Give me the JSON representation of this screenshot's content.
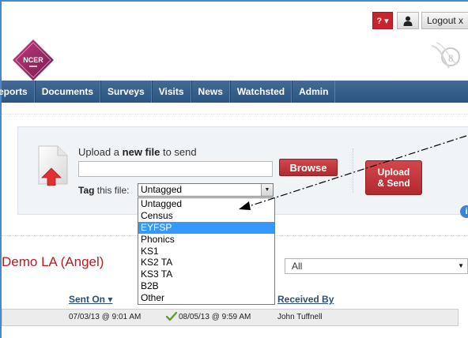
{
  "header": {
    "help_label": "? ▾",
    "logout_label": "Logout x",
    "logo_text": "NCER"
  },
  "nav": {
    "items": [
      "eports",
      "Documents",
      "Surveys",
      "Visits",
      "News",
      "Watchsted",
      "Admin"
    ]
  },
  "upload": {
    "label_pre": "Upload a ",
    "label_bold": "new file",
    "label_post": " to send",
    "browse_label": "Browse",
    "send_line1": "Upload",
    "send_line2": "& Send",
    "tag_label_bold": "Tag",
    "tag_label_rest": " this file:",
    "tag_selected": "Untagged"
  },
  "dropdown": {
    "options": [
      "Untagged",
      "Census",
      "EYFSP",
      "Phonics",
      "KS1",
      "KS2 TA",
      "KS3 TA",
      "B2B",
      "Other"
    ],
    "highlighted_index": 2
  },
  "section": {
    "title": "Demo LA (Angel)",
    "filter_value": "All"
  },
  "table": {
    "headers": {
      "sent_on": "Sent On ▾",
      "received_by": "Received By"
    },
    "rows": [
      {
        "sent_on": "07/03/13 @ 9:01 AM",
        "received_on": "08/05/13 @ 9:59 AM",
        "received_by": "John Tuffnell"
      }
    ]
  },
  "colors": {
    "nav_bg": "#2c5582",
    "accent_red": "#b02a2f",
    "highlight_blue": "#3399ff",
    "title_red": "#b31e24"
  }
}
